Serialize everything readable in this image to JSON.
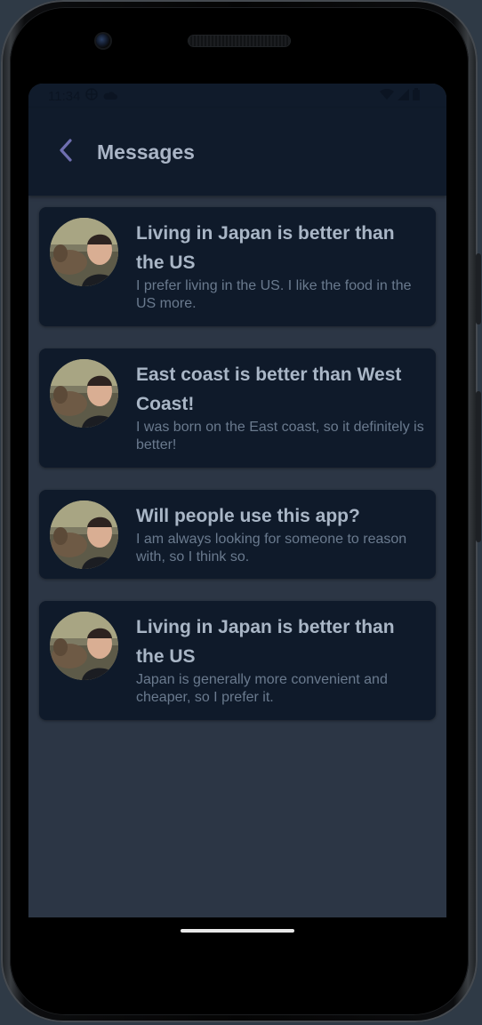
{
  "status_bar": {
    "time": "11:34"
  },
  "header": {
    "title": "Messages",
    "back_icon": "chevron-left-icon"
  },
  "messages": [
    {
      "title": "Living in Japan is better than the US",
      "preview": "I prefer living in the US. I like the food in the US more."
    },
    {
      "title": "East coast is better than West Coast!",
      "preview": "I was born on the East coast, so it definitely is better!"
    },
    {
      "title": "Will people use this app?",
      "preview": "I am always looking for someone to reason with, so I think so."
    },
    {
      "title": "Living in Japan is better than the US",
      "preview": "Japan is generally more convenient and cheaper, so I prefer it."
    }
  ],
  "colors": {
    "background": "#2c3645",
    "surface": "#0f1a2a",
    "title_text": "#a9b6c6",
    "preview_text": "#6a7a8e",
    "accent": "#6f6fb0"
  }
}
